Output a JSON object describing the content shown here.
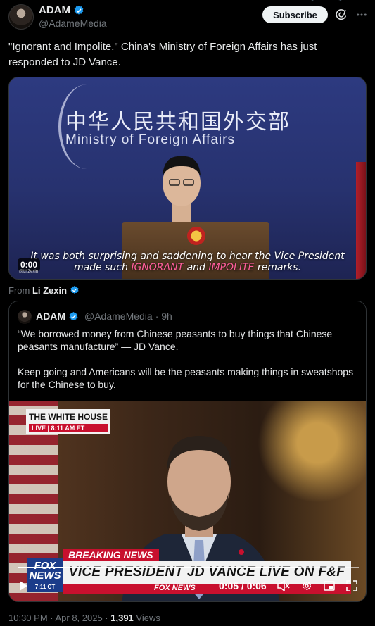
{
  "header": {
    "name": "ADAM",
    "handle": "@AdameMedia",
    "subscribe_label": "Subscribe"
  },
  "tweet": {
    "text": "\"Ignorant and Impolite.\" China's Ministry of Foreign Affairs has just responded to JD Vance."
  },
  "media1": {
    "sign_chinese": "中华人民共和国外交部",
    "sign_english": "Ministry of Foreign Affairs",
    "caption_line1": "It was both surprising and saddening to hear the Vice President",
    "caption_pre": "made such ",
    "caption_hl1": "IGNORANT",
    "caption_mid": " and ",
    "caption_hl2": "IMPOLITE",
    "caption_post": " remarks.",
    "time": "0:00",
    "watermark": "@Li Zexin"
  },
  "from": {
    "prefix": "From ",
    "source": "Li Zexin"
  },
  "quote": {
    "name": "ADAM",
    "handle": "@AdameMedia",
    "age": "· 9h",
    "para1": "“We borrowed money from Chinese peasants to buy things that Chinese peasants manufacture” — JD Vance.",
    "para2": "Keep going and Americans will be the peasants making things in sweatshops for the Chinese to buy.",
    "video": {
      "wh_title": "THE WHITE HOUSE",
      "wh_live": "LIVE | 8:11 AM ET",
      "breaking": "BREAKING NEWS",
      "chyron": "VICE PRESIDENT JD VANCE LIVE ON F&F",
      "fox_logo": "FOX NEWS",
      "fox_time": "7:11 CT",
      "fox_bar": "FOX NEWS",
      "timecode": "0:05 / 0:06",
      "progress": 0.83
    }
  },
  "footer": {
    "time": "10:30 PM · Apr 8, 2025 · ",
    "views_count": "1,391",
    "views_label": " Views"
  },
  "colors": {
    "accent": "#1d9bf0",
    "muted": "#71767b",
    "breaking_red": "#c8102e"
  }
}
